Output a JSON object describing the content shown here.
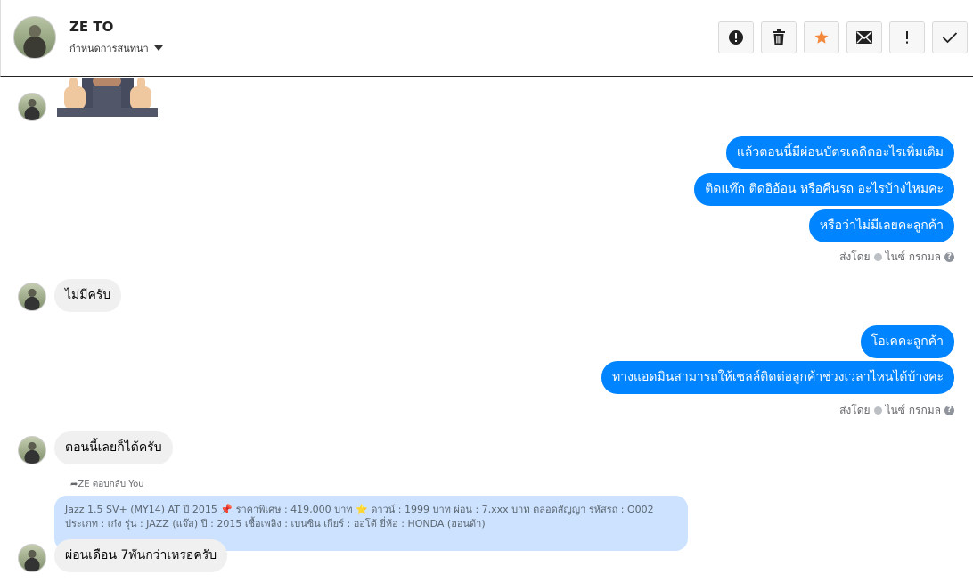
{
  "header": {
    "name": "ZE TO",
    "subtitle": "กำหนดการสนทนา",
    "actions": [
      "alert",
      "trash",
      "star",
      "mail",
      "exclaim",
      "check"
    ]
  },
  "colors": {
    "outgoing": "#0084ff",
    "incoming": "#f0f0f0",
    "star": "#f5883a",
    "quote": "#cce2ff"
  },
  "messages": {
    "out1": "แล้วตอนนี้มีผ่อนบัตรเคดิตอะไรเพิ่มเติม",
    "out2": "ติดแท๊ก ติดอิอ้อน หรือคืนรถ อะไรบ้างไหมคะ",
    "out3": "หรือว่าไม่มีเลยคะลูกค้า",
    "sent_by_1": "ส่งโดย",
    "agent_1": "ไนซ์ กรกมล",
    "in1": "ไม่มีครับ",
    "out4": "โอเคคะลูกค้า",
    "out5": "ทางแอดมินสามารถให้เซลล์ติดต่อลูกค้าช่วงเวลาไหนได้บ้างคะ",
    "sent_by_2": "ส่งโดย",
    "agent_2": "ไนซ์ กรกมล",
    "in2": "ตอนนี้เลยก็ได้ครับ",
    "reply_label": "ZE ตอบกลับ You",
    "quote_line1_a": "Jazz 1.5 SV+ (MY14) AT ปี 2015",
    "quote_line1_b": "ราคาพิเศษ : 419,000 บาท",
    "quote_line1_c": "ดาวน์ : 1999 บาท ผ่อน : 7,xxx บาท ตลอดสัญญา รหัสรถ : O002",
    "quote_line2": "ประเภท : เก๋ง รุ่น : JAZZ (แจ๊ส) ปี : 2015 เชื้อเพลิง : เบนซิน เกียร์ : ออโต้ ยี่ห้อ : HONDA (ฮอนด้า)",
    "in3": "ผ่อนเดือน 7พันกว่าเหรอครับ"
  }
}
